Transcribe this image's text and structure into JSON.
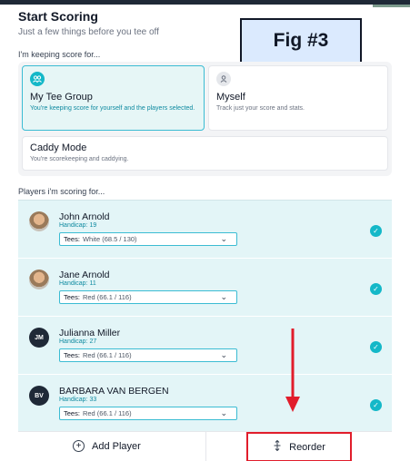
{
  "header": {
    "title": "Start Scoring",
    "subtitle": "Just a few things before you tee off"
  },
  "figure_label": "Fig #3",
  "keeping": {
    "label": "I'm keeping score for...",
    "options": [
      {
        "title": "My Tee Group",
        "desc": "You're keeping score for yourself and the players selected.",
        "icon": "group-icon",
        "selected": true
      },
      {
        "title": "Myself",
        "desc": "Track just your score and stats.",
        "icon": "person-icon",
        "selected": false
      },
      {
        "title": "Caddy Mode",
        "desc": "You're scorekeeping and caddying.",
        "selected": false
      }
    ]
  },
  "players": {
    "label": "Players i'm scoring for...",
    "tees_label": "Tees:",
    "items": [
      {
        "name": "John Arnold",
        "handicap": "Handicap: 19",
        "tees": "White (68.5 / 130)",
        "avatar": "photo",
        "checked": true
      },
      {
        "name": "Jane Arnold",
        "handicap": "Handicap: 11",
        "tees": "Red (66.1 / 116)",
        "avatar": "photo",
        "checked": true
      },
      {
        "name": "Julianna Miller",
        "handicap": "Handicap: 27",
        "tees": "Red (66.1 / 116)",
        "initials": "JM",
        "checked": true
      },
      {
        "name": "BARBARA VAN BERGEN",
        "handicap": "Handicap: 33",
        "tees": "Red (66.1 / 116)",
        "initials": "BV",
        "checked": true
      }
    ]
  },
  "actions": {
    "add_player": "Add Player",
    "reorder": "Reorder"
  },
  "colors": {
    "accent": "#14b8c8",
    "annotation_red": "#e11d2b",
    "players_bg": "#e3f5f7"
  }
}
